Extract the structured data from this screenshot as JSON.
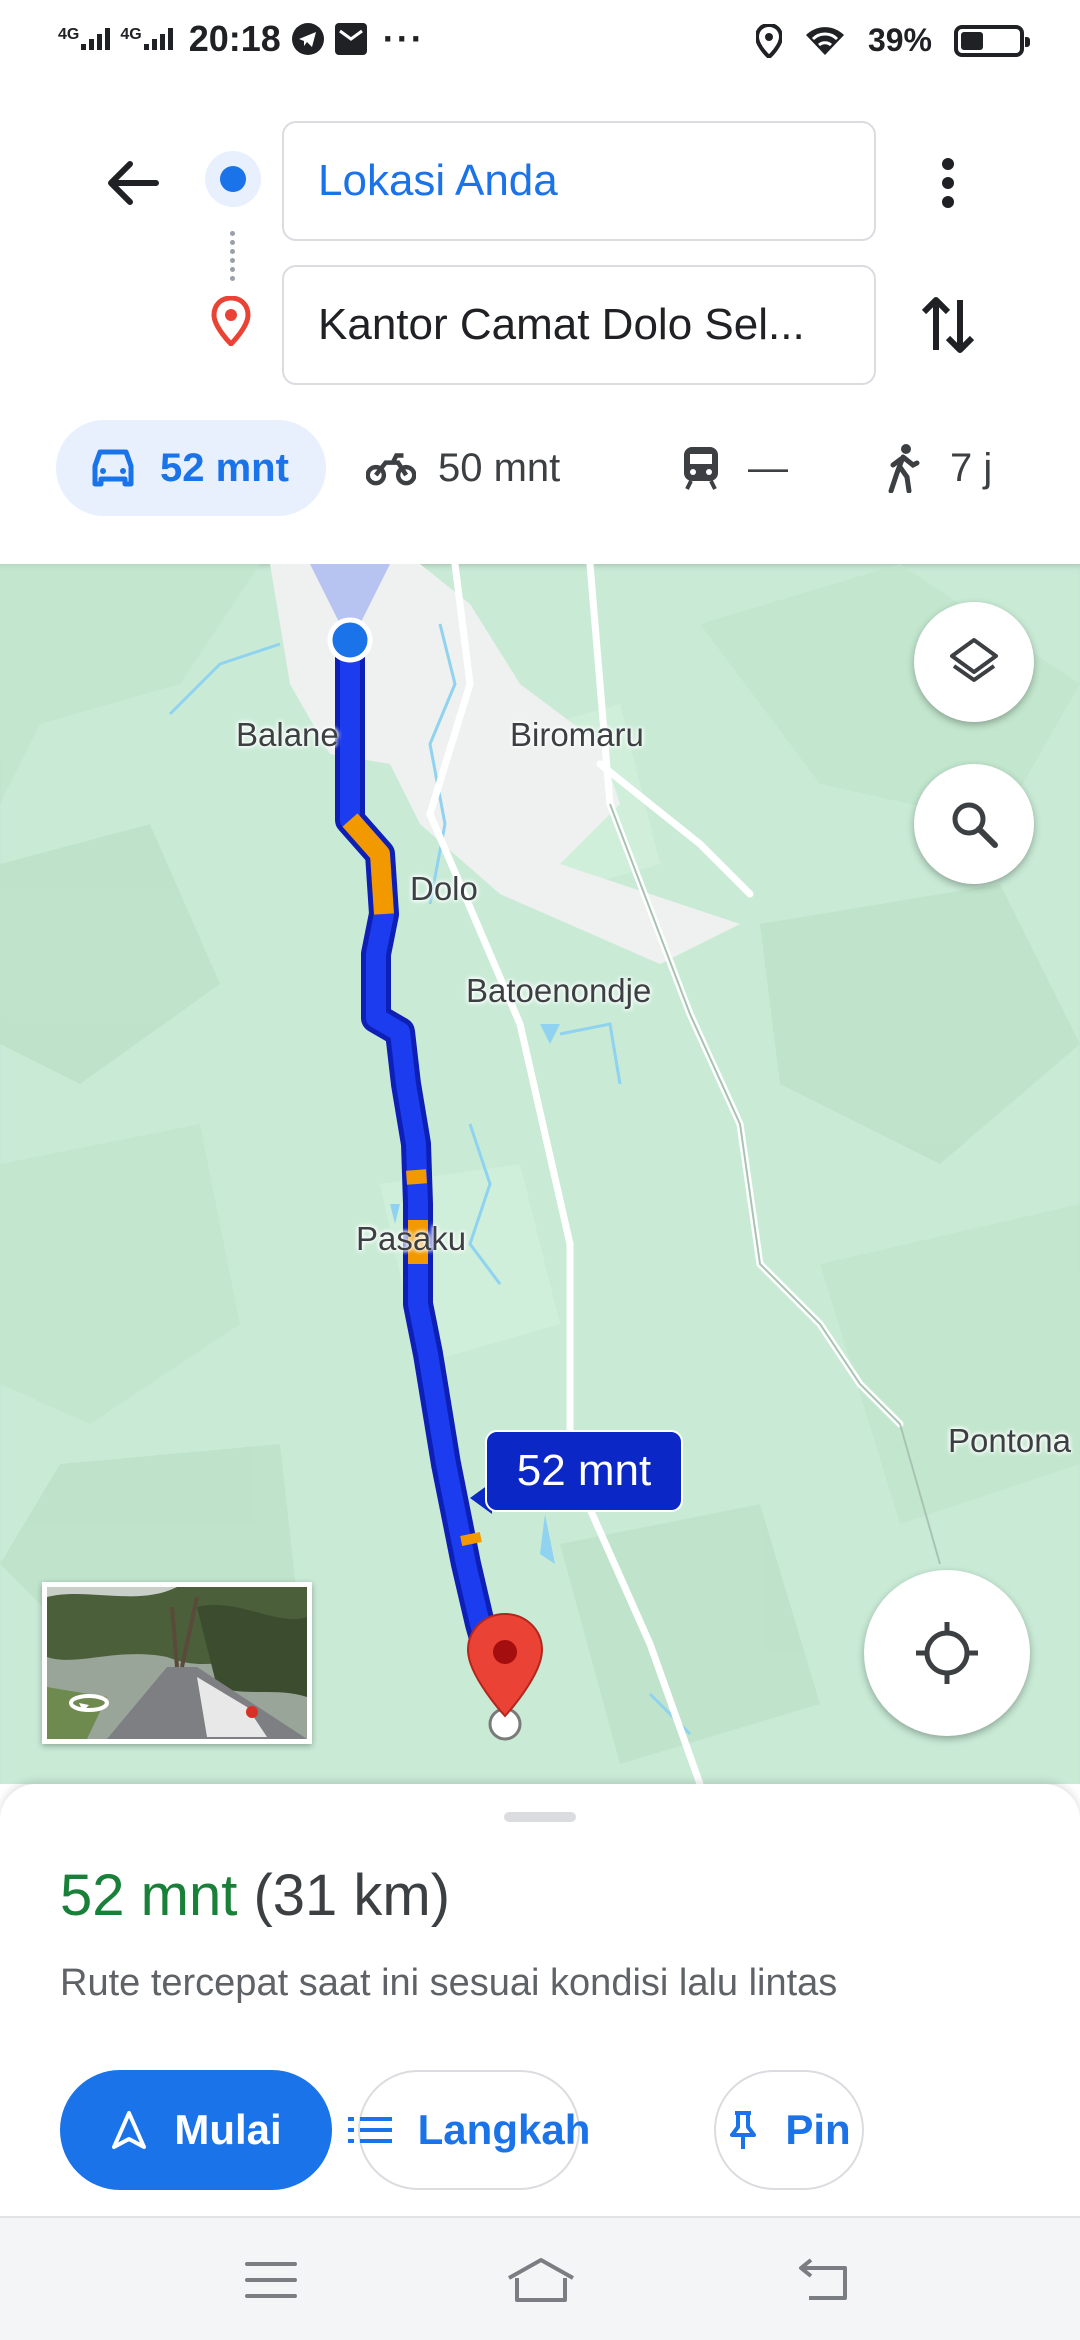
{
  "status_bar": {
    "network_1": "4G",
    "network_2": "4G",
    "time": "20:18",
    "more": "···",
    "battery_percent": "39%",
    "battery_level": 0.39,
    "icons": [
      "telegram-icon",
      "mail-icon",
      "location-icon",
      "wifi-icon",
      "battery-icon"
    ]
  },
  "directions": {
    "origin": "Lokasi Anda",
    "destination": "Kantor Camat Dolo Sel...",
    "modes": [
      {
        "icon": "car-icon",
        "label": "52 mnt",
        "active": true
      },
      {
        "icon": "motorcycle-icon",
        "label": "50 mnt",
        "active": false
      },
      {
        "icon": "transit-icon",
        "label": "—",
        "active": false
      },
      {
        "icon": "walk-icon",
        "label": "7 j",
        "active": false
      }
    ]
  },
  "map": {
    "labels": {
      "balane": "Balane",
      "biromaru": "Biromaru",
      "dolo": "Dolo",
      "batoenondje": "Batoenondje",
      "pasaku": "Pasaku",
      "pontona": "Pontona"
    },
    "eta_label": "52 mnt",
    "colors": {
      "route": "#1c3cf0",
      "traffic_slow": "#f29900",
      "destination_pin": "#ea4335",
      "land": "#c9ebd6"
    }
  },
  "sheet": {
    "duration": "52 mnt",
    "distance": "(31 km)",
    "description": "Rute tercepat saat ini sesuai kondisi lalu lintas",
    "start_label": "Mulai",
    "steps_label": "Langkah",
    "pin_label": "Pin"
  },
  "nav_bar": {
    "icons": [
      "menu-icon",
      "home-icon",
      "back-icon"
    ]
  }
}
